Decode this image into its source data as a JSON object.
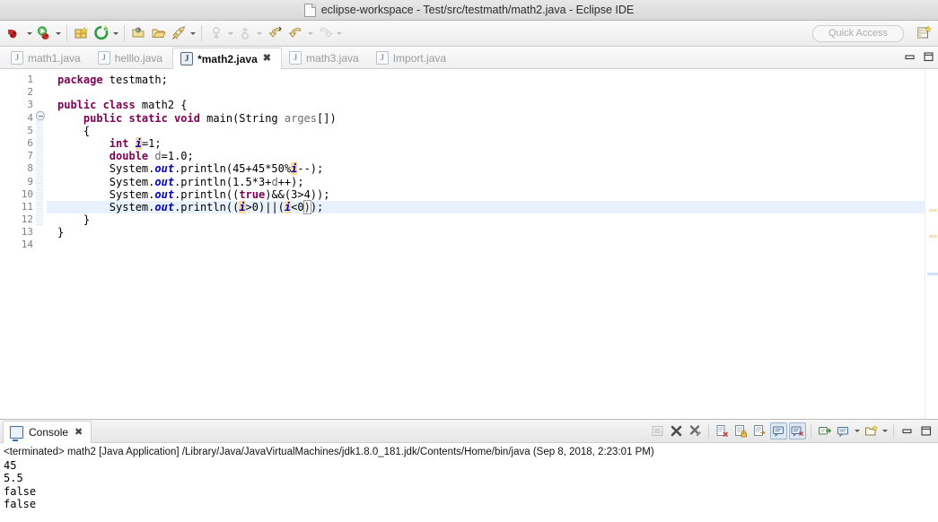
{
  "window": {
    "title": "eclipse-workspace - Test/src/testmath/math2.java - Eclipse IDE",
    "doc_icon": "document-icon"
  },
  "toolbar": {
    "quick_access_placeholder": "Quick Access",
    "buttons": [
      {
        "name": "debug-button",
        "icon": "debug-icon"
      },
      {
        "name": "run-button",
        "icon": "run-icon"
      },
      {
        "name": "new-java-package-button",
        "icon": "package-icon"
      },
      {
        "name": "external-tools-button",
        "icon": "external-tools-icon"
      },
      {
        "name": "open-type-button",
        "icon": "open-type-icon"
      },
      {
        "name": "open-task-button",
        "icon": "open-task-icon"
      },
      {
        "name": "search-button",
        "icon": "search-rocket-icon"
      },
      {
        "name": "next-annotation-button",
        "icon": "next-annotation-icon"
      },
      {
        "name": "previous-annotation-button",
        "icon": "previous-annotation-icon"
      },
      {
        "name": "back-button",
        "icon": "back-arrow-icon"
      },
      {
        "name": "forward-button",
        "icon": "forward-arrow-icon"
      },
      {
        "name": "last-edit-location-button",
        "icon": "last-edit-icon"
      }
    ],
    "perspective_switcher": "open-perspective-icon"
  },
  "editor": {
    "tabs": [
      {
        "label": "math1.java",
        "icon": "java-file-icon",
        "active": false,
        "dirty": false,
        "closable": false
      },
      {
        "label": "helllo.java",
        "icon": "java-file-icon",
        "active": false,
        "dirty": false,
        "closable": false
      },
      {
        "label": "*math2.java",
        "icon": "java-file-icon",
        "active": true,
        "dirty": true,
        "closable": true
      },
      {
        "label": "math3.java",
        "icon": "java-file-icon",
        "active": false,
        "dirty": false,
        "closable": false
      },
      {
        "label": "Import.java",
        "icon": "java-file-icon",
        "active": false,
        "dirty": false,
        "closable": false
      }
    ],
    "close_glyph": "✖",
    "minimize_label": "minimize-icon",
    "maximize_label": "maximize-icon",
    "line_numbers": [
      1,
      2,
      3,
      4,
      5,
      6,
      7,
      8,
      9,
      10,
      11,
      12,
      13,
      14
    ],
    "current_line": 11,
    "fold_marker_line": 4,
    "code_lines": [
      {
        "n": 1,
        "text": "package testmath;"
      },
      {
        "n": 2,
        "text": ""
      },
      {
        "n": 3,
        "text": "public class math2 {"
      },
      {
        "n": 4,
        "text": "    public static void main(String arges[])"
      },
      {
        "n": 5,
        "text": "    {"
      },
      {
        "n": 6,
        "text": "        int i=1;"
      },
      {
        "n": 7,
        "text": "        double d=1.0;"
      },
      {
        "n": 8,
        "text": "        System.out.println(45+45*50%i--);"
      },
      {
        "n": 9,
        "text": "        System.out.println(1.5*3+d++);"
      },
      {
        "n": 10,
        "text": "        System.out.println((true)&&(3>4));"
      },
      {
        "n": 11,
        "text": "        System.out.println((i>0)||(i<0));"
      },
      {
        "n": 12,
        "text": "    }"
      },
      {
        "n": 13,
        "text": "}"
      },
      {
        "n": 14,
        "text": ""
      }
    ]
  },
  "console": {
    "tab_label": "Console",
    "tab_icon": "console-icon",
    "close_glyph": "✖",
    "header": "<terminated> math2 [Java Application] /Library/Java/JavaVirtualMachines/jdk1.8.0_181.jdk/Contents/Home/bin/java (Sep 8, 2018, 2:23:01 PM)",
    "output": "45\n5.5\nfalse\nfalse",
    "output_lines": [
      "45",
      "5.5",
      "false",
      "false"
    ],
    "tools": [
      {
        "name": "console-show-when-output-button",
        "icon": "list-icon"
      },
      {
        "name": "terminate-button",
        "icon": "terminate-x-icon"
      },
      {
        "name": "remove-all-terminated-button",
        "icon": "remove-terminated-icon"
      },
      {
        "name": "clear-console-button",
        "icon": "clear-console-icon"
      },
      {
        "name": "scroll-lock-button",
        "icon": "scroll-lock-icon"
      },
      {
        "name": "word-wrap-button",
        "icon": "word-wrap-icon"
      },
      {
        "name": "pin-console-button",
        "icon": "pin-console-icon"
      },
      {
        "name": "display-selected-console-button",
        "icon": "display-console-icon"
      },
      {
        "name": "open-console-button",
        "icon": "open-console-icon"
      },
      {
        "name": "new-console-view-button",
        "icon": "new-console-icon"
      },
      {
        "name": "minimize-console-button",
        "icon": "minimize-icon"
      },
      {
        "name": "maximize-console-button",
        "icon": "maximize-icon"
      }
    ]
  },
  "colors": {
    "keyword": "#7f0055",
    "field": "#0000c0",
    "occurrence_highlight": "#f9d9a0",
    "current_line_highlight": "#e8f2fe",
    "titlebar_bg": "#e0e0e0"
  }
}
